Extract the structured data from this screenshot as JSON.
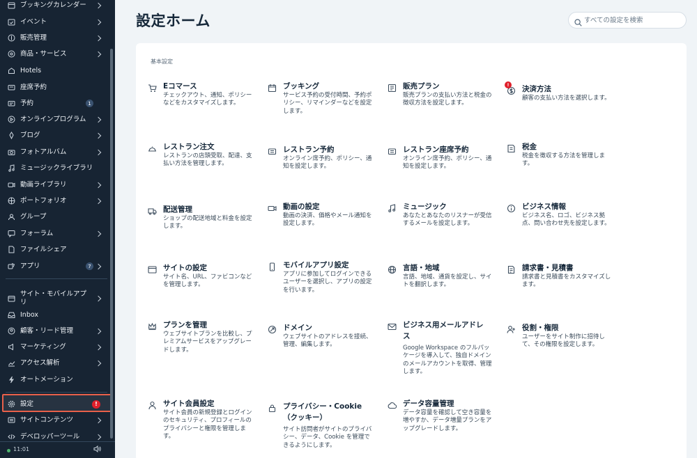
{
  "sidebar": {
    "items": [
      {
        "label": "ブッキングカレンダー",
        "icon": "calendar-icon",
        "chevron": true
      },
      {
        "label": "イベント",
        "icon": "event-icon",
        "chevron": true
      },
      {
        "label": "販売管理",
        "icon": "dollar-icon",
        "chevron": true
      },
      {
        "label": "商品・サービス",
        "icon": "products-icon",
        "chevron": true
      },
      {
        "label": "Hotels",
        "icon": "hotel-icon",
        "chevron": false
      },
      {
        "label": "座席予約",
        "icon": "seat-icon",
        "chevron": false
      },
      {
        "label": "予約",
        "icon": "reservation-icon",
        "chevron": false,
        "count": "1"
      },
      {
        "label": "オンラインプログラム",
        "icon": "program-icon",
        "chevron": true
      },
      {
        "label": "ブログ",
        "icon": "blog-icon",
        "chevron": true
      },
      {
        "label": "フォトアルバム",
        "icon": "camera-icon",
        "chevron": true
      },
      {
        "label": "ミュージックライブラリ",
        "icon": "music-icon",
        "chevron": false
      },
      {
        "label": "動画ライブラリ",
        "icon": "video-icon",
        "chevron": true
      },
      {
        "label": "ポートフォリオ",
        "icon": "portfolio-icon",
        "chevron": true
      },
      {
        "label": "グループ",
        "icon": "group-icon",
        "chevron": false
      },
      {
        "label": "フォーラム",
        "icon": "forum-icon",
        "chevron": true
      },
      {
        "label": "ファイルシェア",
        "icon": "file-share-icon",
        "chevron": false
      },
      {
        "label": "アプリ",
        "icon": "apps-icon",
        "chevron": true,
        "count": "7"
      },
      {
        "label": "サイト・モバイルアプリ",
        "icon": "site-app-icon",
        "chevron": true
      },
      {
        "label": "Inbox",
        "icon": "inbox-icon",
        "chevron": false
      },
      {
        "label": "顧客・リード管理",
        "icon": "contacts-icon",
        "chevron": true
      },
      {
        "label": "マーケティング",
        "icon": "marketing-icon",
        "chevron": true
      },
      {
        "label": "アクセス解析",
        "icon": "analytics-icon",
        "chevron": true
      },
      {
        "label": "オートメーション",
        "icon": "automation-icon",
        "chevron": false
      },
      {
        "label": "設定",
        "icon": "gear-icon",
        "chevron": false,
        "alert": "!"
      },
      {
        "label": "サイトコンテンツ",
        "icon": "content-icon",
        "chevron": true
      },
      {
        "label": "デベロッパーツール",
        "icon": "code-icon",
        "chevron": true
      }
    ],
    "footer": {
      "time": "11:01",
      "speaker_icon": "speaker-icon"
    }
  },
  "header": {
    "title": "設定ホーム",
    "search_placeholder": "すべての設定を検索"
  },
  "main": {
    "section_label": "基本設定",
    "tiles": [
      {
        "title": "Eコマース",
        "desc": "チェックアウト、通知、ポリシーなどをカスタマイズします。",
        "icon": "cart-icon"
      },
      {
        "title": "ブッキング",
        "desc": "サービス予約の受付時間、予約ポリシー、リマインダーなどを設定します。",
        "icon": "booking-calendar-icon"
      },
      {
        "title": "販売プラン",
        "desc": "販売プランの支払い方法と税金の徴収方法を設定します。",
        "icon": "pricing-plan-icon"
      },
      {
        "title": "決済方法",
        "desc": "顧客の支払い方法を選択します。",
        "icon": "payment-icon",
        "alert": "!"
      },
      {
        "title": "レストラン注文",
        "desc": "レストランの店頭受取、配達、支払い方法を管理します。",
        "icon": "restaurant-order-icon"
      },
      {
        "title": "レストラン予約",
        "desc": "オンライン席予約、ポリシー、通知を設定します。",
        "icon": "restaurant-reservation-icon"
      },
      {
        "title": "レストラン座席予約",
        "desc": "オンライン席予約、ポリシー、通知を設定します。",
        "icon": "restaurant-seat-icon"
      },
      {
        "title": "税金",
        "desc": "税金を徴収する方法を管理します。",
        "icon": "tax-icon"
      },
      {
        "title": "配送管理",
        "desc": "ショップの配送地域と料金を設定します。",
        "icon": "truck-icon"
      },
      {
        "title": "動画の設定",
        "desc": "動画の決済、価格やメール通知を設定します。",
        "icon": "video-camera-icon"
      },
      {
        "title": "ミュージック",
        "desc": "あなたとあなたのリスナーが受信するメールを設定します。",
        "icon": "music-note-icon"
      },
      {
        "title": "ビジネス情報",
        "desc": "ビジネス名、ロゴ、ビジネス拠点、問い合わせ先を設定します。",
        "icon": "info-icon"
      },
      {
        "title": "サイトの設定",
        "desc": "サイト名、URL、ファビコンなどを管理します。",
        "icon": "browser-window-icon"
      },
      {
        "title": "モバイルアプリ設定",
        "desc": "アプリに参加してログインできるユーザーを選択し、アプリの設定を行います。",
        "icon": "mobile-icon"
      },
      {
        "title": "言語・地域",
        "desc": "言語、地域、通貨を設定し、サイトを翻訳します。",
        "icon": "globe-icon"
      },
      {
        "title": "請求書・見積書",
        "desc": "請求書と見積書をカスタマイズします。",
        "icon": "invoice-icon"
      },
      {
        "title": "プランを管理",
        "desc": "ウェブサイトプランを比較し、プレミアムサービスをアップグレードします。",
        "icon": "crown-icon"
      },
      {
        "title": "ドメイン",
        "desc": "ウェブサイトのアドレスを接続、管理、編集します。",
        "icon": "domain-icon"
      },
      {
        "title": "ビジネス用メールアドレス",
        "desc": "Google Workspace のフルパッケージを導入して、独自ドメインのメールアカウントを取得、管理します。",
        "icon": "mail-icon"
      },
      {
        "title": "役割・権限",
        "desc": "ユーザーをサイト制作に招待して、その権限を設定します。",
        "icon": "roles-icon"
      },
      {
        "title": "サイト会員設定",
        "desc": "サイト会員の新規登録とログインのセキュリティ、プロフィールのプライバシーと権限を管理します。",
        "icon": "member-icon"
      },
      {
        "title": "プライバシー・Cookie（クッキー）",
        "desc": "サイト訪問者がサイトのプライバシー、データ、Cookie を管理できるようにします。",
        "icon": "lock-icon"
      },
      {
        "title": "データ容量管理",
        "desc": "データ容量を確認して空き容量を増やすか、データ増量プランをアップグレードします。",
        "icon": "cloud-icon"
      }
    ]
  }
}
